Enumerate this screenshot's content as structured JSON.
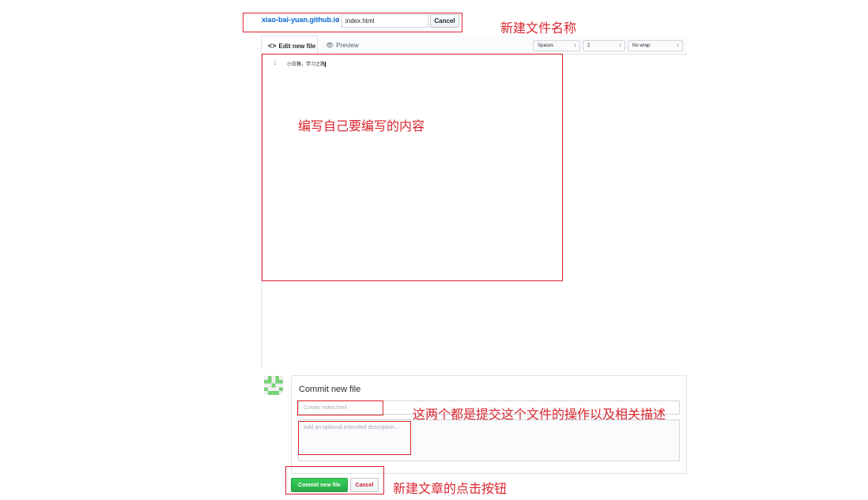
{
  "path": {
    "repo_name": "xiao-bai-yuan.github.io",
    "separator": "/",
    "filename_value": "index.html",
    "cancel_label": "Cancel"
  },
  "editor": {
    "tab_edit_label": "Edit new file",
    "tab_preview_label": "Preview",
    "indent_mode": "Spaces",
    "indent_size": "2",
    "wrap_mode": "No wrap",
    "lines": [
      {
        "number": "1",
        "text": "小白猿，学习之路"
      }
    ]
  },
  "commit": {
    "title": "Commit new file",
    "summary_placeholder": "Create index.html",
    "description_placeholder": "Add an optional extended description...",
    "commit_button_label": "Commit new file",
    "cancel_button_label": "Cancel"
  },
  "annotations": {
    "filename_note": "新建文件名称",
    "content_note": "编写自己要编写的内容",
    "commit_fields_note": "这两个都是提交这个文件的操作以及相关描述",
    "buttons_note": "新建文章的点击按钮"
  },
  "colors": {
    "annotation_red": "#d9262e",
    "link_blue": "#0366d6",
    "commit_green": "#28a745"
  },
  "icons": {
    "code": "code-icon",
    "preview": "eye-icon",
    "avatar": "identicon-avatar"
  }
}
